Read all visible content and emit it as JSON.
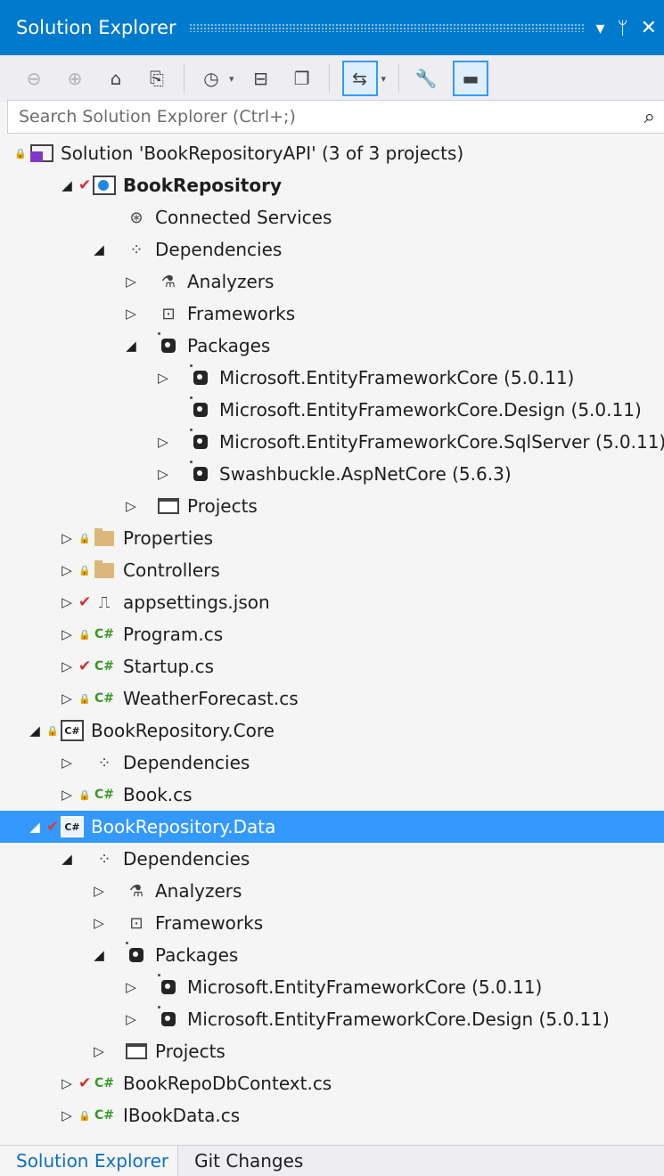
{
  "window": {
    "title": "Solution Explorer",
    "dropdown_glyph": "▾",
    "pin_glyph": "ᛘ",
    "close_glyph": "✕"
  },
  "toolbar": {
    "buttons": [
      {
        "name": "back-icon",
        "glyph": "⊖"
      },
      {
        "name": "forward-icon",
        "glyph": "⊕"
      },
      {
        "name": "home-icon",
        "glyph": "⌂"
      },
      {
        "name": "switch-views-icon",
        "glyph": "⎘"
      },
      {
        "name": "pending-changes-filter-icon",
        "glyph": "◷"
      },
      {
        "name": "collapse-all-icon",
        "glyph": "⊟"
      },
      {
        "name": "show-all-files-icon",
        "glyph": "❐"
      },
      {
        "name": "sync-with-active-document-icon",
        "glyph": "⇆"
      },
      {
        "name": "properties-icon",
        "glyph": "🔧"
      },
      {
        "name": "preview-selected-items-icon",
        "glyph": "▬"
      }
    ]
  },
  "search": {
    "placeholder": "Search Solution Explorer (Ctrl+;)",
    "icon": "⌕"
  },
  "tree": [
    {
      "label": "Solution 'BookRepositoryAPI' (3 of 3 projects)",
      "icon": "solution",
      "lock": true
    },
    {
      "label": "BookRepository",
      "icon": "webproject",
      "check": true,
      "expanded": true,
      "bold": true
    },
    {
      "label": "Connected Services",
      "icon": "connected-services"
    },
    {
      "label": "Dependencies",
      "icon": "dependencies",
      "expanded": true
    },
    {
      "label": "Analyzers",
      "icon": "analyzers",
      "expanded": false
    },
    {
      "label": "Frameworks",
      "icon": "frameworks",
      "expanded": false
    },
    {
      "label": "Packages",
      "icon": "package",
      "expanded": true
    },
    {
      "label": "Microsoft.EntityFrameworkCore (5.0.11)",
      "icon": "package",
      "expanded": false
    },
    {
      "label": "Microsoft.EntityFrameworkCore.Design (5.0.11)",
      "icon": "package"
    },
    {
      "label": "Microsoft.EntityFrameworkCore.SqlServer (5.0.11)",
      "icon": "package",
      "expanded": false
    },
    {
      "label": "Swashbuckle.AspNetCore (5.6.3)",
      "icon": "package",
      "expanded": false
    },
    {
      "label": "Projects",
      "icon": "projects",
      "expanded": false
    },
    {
      "label": "Properties",
      "icon": "properties-folder",
      "lock": true,
      "expanded": false
    },
    {
      "label": "Controllers",
      "icon": "folder",
      "lock": true,
      "expanded": false
    },
    {
      "label": "appsettings.json",
      "icon": "json",
      "check": true,
      "expanded": false
    },
    {
      "label": "Program.cs",
      "icon": "csharp",
      "lock": true,
      "expanded": false
    },
    {
      "label": "Startup.cs",
      "icon": "csharp",
      "check": true,
      "expanded": false
    },
    {
      "label": "WeatherForecast.cs",
      "icon": "csharp",
      "lock": true,
      "expanded": false
    },
    {
      "label": "BookRepository.Core",
      "icon": "csproject",
      "lock": true,
      "expanded": true
    },
    {
      "label": "Dependencies",
      "icon": "dependencies",
      "expanded": false
    },
    {
      "label": "Book.cs",
      "icon": "csharp",
      "lock": true,
      "expanded": false
    },
    {
      "label": "BookRepository.Data",
      "icon": "csproject",
      "check": true,
      "expanded": true,
      "selected": true
    },
    {
      "label": "Dependencies",
      "icon": "dependencies",
      "expanded": true
    },
    {
      "label": "Analyzers",
      "icon": "analyzers",
      "expanded": false
    },
    {
      "label": "Frameworks",
      "icon": "frameworks",
      "expanded": false
    },
    {
      "label": "Packages",
      "icon": "package",
      "expanded": true
    },
    {
      "label": "Microsoft.EntityFrameworkCore (5.0.11)",
      "icon": "package",
      "expanded": false
    },
    {
      "label": "Microsoft.EntityFrameworkCore.Design (5.0.11)",
      "icon": "package",
      "expanded": false
    },
    {
      "label": "Projects",
      "icon": "projects",
      "expanded": false
    },
    {
      "label": "BookRepoDbContext.cs",
      "icon": "csharp",
      "check": true,
      "expanded": false
    },
    {
      "label": "IBookData.cs",
      "icon": "csharp",
      "lock": true,
      "expanded": false
    }
  ],
  "bottom_tabs": [
    {
      "label": "Solution Explorer",
      "active": true
    },
    {
      "label": "Git Changes",
      "active": false
    }
  ],
  "colors": {
    "accent": "#007acc",
    "selection": "#3399ff",
    "check": "#d32f2f",
    "lock": "#1e6fd6",
    "csharp": "#389a25"
  }
}
